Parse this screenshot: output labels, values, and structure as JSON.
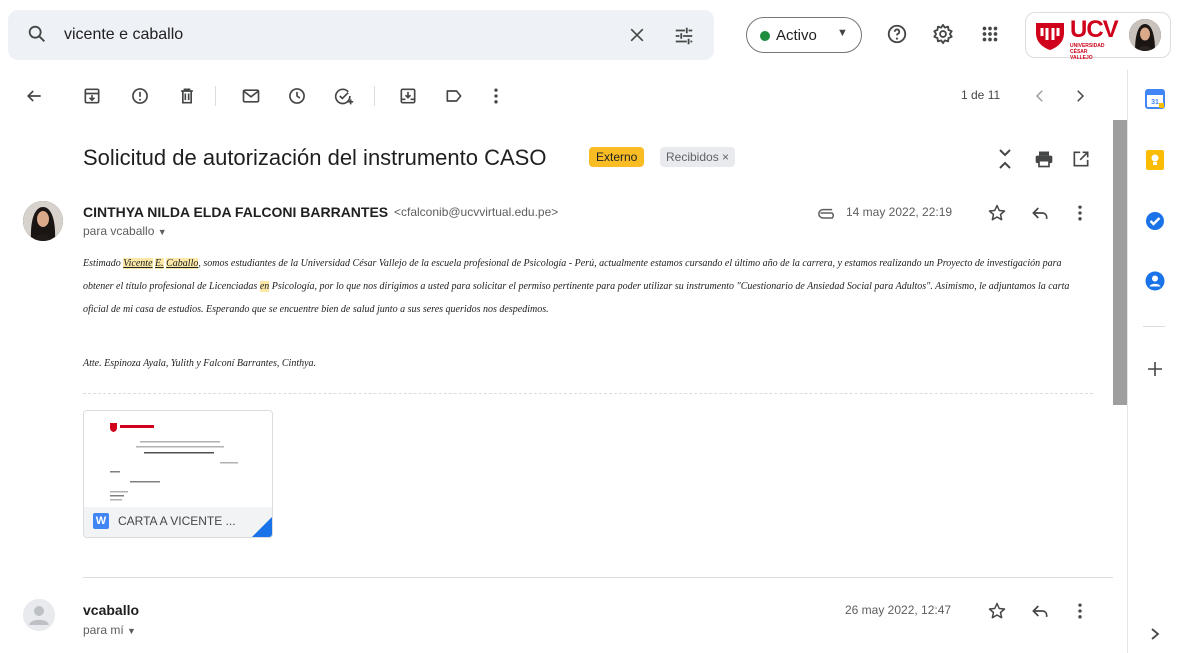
{
  "search": {
    "query": "vicente e caballo"
  },
  "header": {
    "status_label": "Activo",
    "org_logo_text": "UCV",
    "org_logo_sub": "UNIVERSIDAD CÉSAR VALLEJO"
  },
  "toolbar": {
    "counter": "1 de 11"
  },
  "message": {
    "subject": "Solicitud de autorización del instrumento CASO",
    "labels": [
      "Externo",
      "Recibidos ×"
    ],
    "sender_name": "CINTHYA NILDA ELDA FALCONI BARRANTES",
    "sender_email": "<cfalconib@ucvvirtual.edu.pe>",
    "to": "para vcaballo",
    "date": "14 may 2022, 22:19",
    "body": {
      "p1_a": "Estimado ",
      "hl1": "Vicente",
      "p1_b": " ",
      "hl2": "E.",
      "p1_c": " ",
      "hl3": "Caballo",
      "p1_d": ", somos estudiantes de la Universidad César Vallejo de la escuela profesional  de Psicología - Perú, actualmente estamos cursando el último año de la carrera, y estamos realizando un Proyecto de investigación para obtener el título profesional de Licenciadas ",
      "hl4": "en",
      "p1_e": " Psicología, por lo que nos dirigimos a usted para solicitar el permiso pertinente para poder utilizar su instrumento \"Cuestionario de Ansiedad Social para Adultos\". Asimismo, le adjuntamos la carta oficial de mi casa de estudios. Esperando que se encuentre bien de salud junto a sus seres queridos nos despedimos.",
      "signoff": "Atte.  Espinoza Ayala, Yulith y Falconí Barrantes, Cinthya."
    },
    "attachment": {
      "name": "CARTA A VICENTE ...",
      "type_letter": "W"
    }
  },
  "reply": {
    "sender_name": "vcaballo",
    "to": "para mí",
    "date": "26 may 2022, 12:47"
  },
  "colors": {
    "accent": "#1a73e8",
    "label_externo": "#f9bd23",
    "status_active": "#1e8e3e",
    "brand_red": "#d0021b"
  },
  "icons": [
    "search-icon",
    "clear-icon",
    "filter-icon",
    "help-icon",
    "settings-icon",
    "apps-icon",
    "back-icon",
    "archive-icon",
    "report-spam-icon",
    "delete-icon",
    "mark-unread-icon",
    "snooze-icon",
    "add-task-icon",
    "move-to-icon",
    "label-icon",
    "more-icon",
    "prev-icon",
    "next-icon",
    "collapse-icon",
    "print-icon",
    "open-new-window-icon",
    "attachment-icon",
    "star-icon",
    "reply-icon",
    "calendar-icon",
    "keep-icon",
    "tasks-icon",
    "contacts-icon",
    "add-icon",
    "expand-panel-icon"
  ]
}
